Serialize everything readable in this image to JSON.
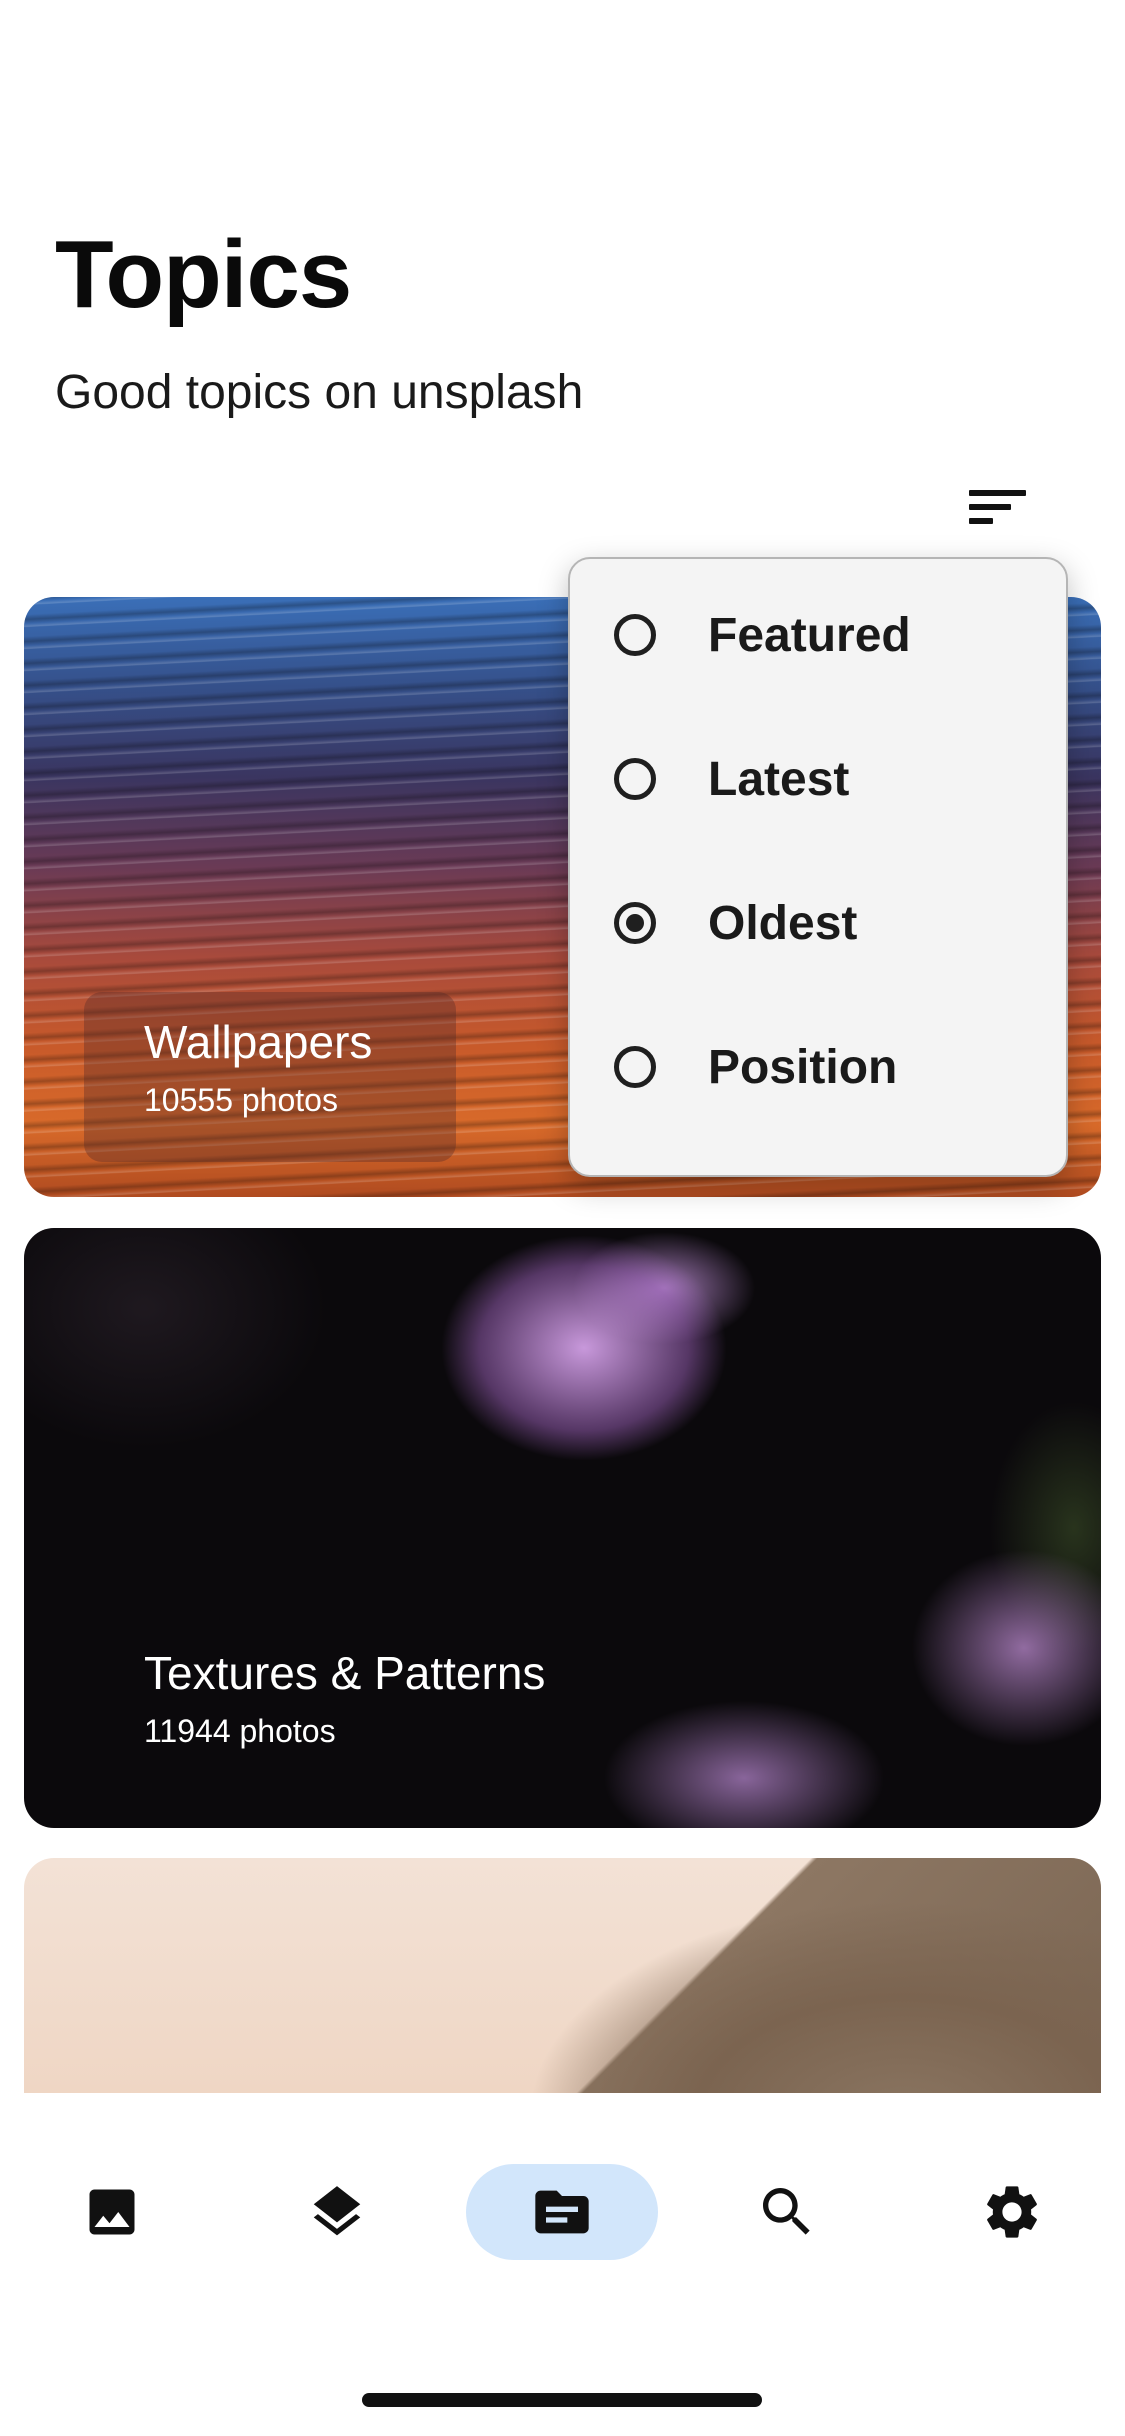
{
  "header": {
    "title": "Topics",
    "subtitle": "Good topics on unsplash"
  },
  "sort_button": {
    "icon": "sort-icon"
  },
  "sort_menu": {
    "options": [
      {
        "label": "Featured",
        "selected": false
      },
      {
        "label": "Latest",
        "selected": false
      },
      {
        "label": "Oldest",
        "selected": true
      },
      {
        "label": "Position",
        "selected": false
      }
    ]
  },
  "topics": [
    {
      "name": "Wallpapers",
      "count": "10555 photos"
    },
    {
      "name": "Textures & Patterns",
      "count": "11944 photos"
    },
    {
      "name": "",
      "count": ""
    }
  ],
  "bottom_nav": {
    "items": [
      {
        "icon": "image-icon",
        "active": false
      },
      {
        "icon": "layers-icon",
        "active": false
      },
      {
        "icon": "topic-icon",
        "active": true
      },
      {
        "icon": "search-icon",
        "active": false
      },
      {
        "icon": "settings-icon",
        "active": false
      }
    ],
    "active_color": "#d2e6fb"
  }
}
